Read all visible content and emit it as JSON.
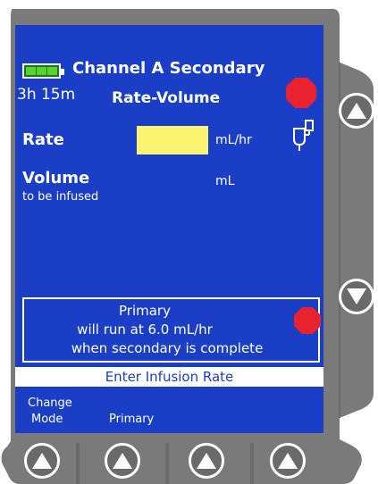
{
  "header": {
    "channel_title": "Channel A Secondary",
    "battery_time": "3h 15m",
    "mode_title": "Rate-Volume"
  },
  "fields": {
    "rate": {
      "label": "Rate",
      "value": "",
      "unit": "mL/hr"
    },
    "volume": {
      "label": "Volume",
      "sublabel": "to be infused",
      "value": "",
      "unit": "mL"
    }
  },
  "primary_notice": {
    "line1": "Primary",
    "line2": "will run at 6.0 mL/hr",
    "line3": "when secondary is complete"
  },
  "prompt": "Enter Infusion Rate",
  "softkeys": {
    "key1_line1": "Change",
    "key1_line2": "Mode",
    "key2": "Primary"
  },
  "colors": {
    "screen": "#1a3ec6",
    "housing": "#7a7a7a",
    "stop": "#e8222e",
    "rate_field": "#fbf470",
    "battery_fill": "#5bd12a"
  },
  "battery": {
    "level": 1.0
  }
}
